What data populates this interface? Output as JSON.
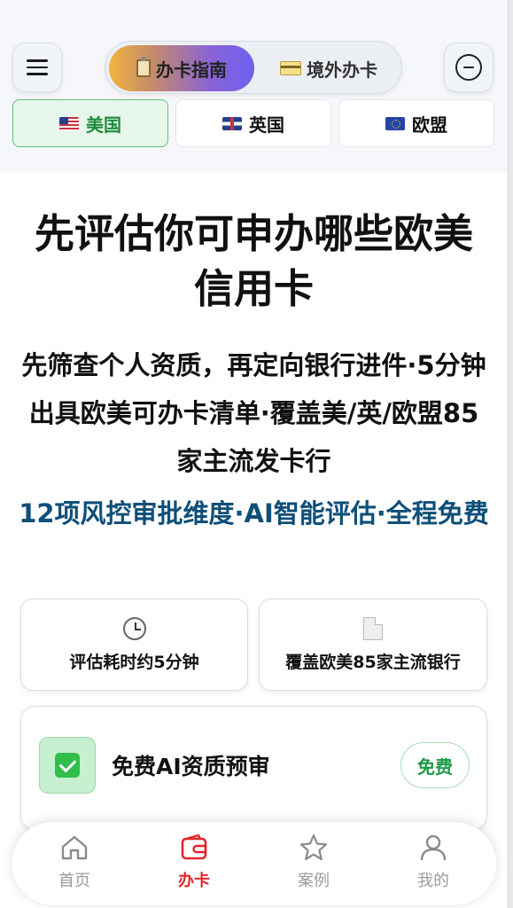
{
  "header": {
    "tabs": [
      {
        "label": "办卡指南",
        "active": true,
        "icon": "clipboard-icon"
      },
      {
        "label": "境外办卡",
        "active": false,
        "icon": "credit-card-icon"
      }
    ],
    "regions": [
      {
        "label": "美国",
        "flag": "us-flag-icon",
        "active": true
      },
      {
        "label": "英国",
        "flag": "uk-flag-icon",
        "active": false
      },
      {
        "label": "欧盟",
        "flag": "eu-flag-icon",
        "active": false
      }
    ]
  },
  "main": {
    "headline": "先评估你可申办哪些欧美信用卡",
    "subline": "先筛查个人资质，再定向银行进件·5分钟出具欧美可办卡清单·覆盖美/英/欧盟85家主流发卡行",
    "accent": "12项风控审批维度·AI智能评估·全程免费",
    "features": [
      {
        "icon": "clock-icon",
        "label": "评估耗时约5分钟"
      },
      {
        "icon": "document-icon",
        "label": "覆盖欧美85家主流银行"
      }
    ],
    "review": {
      "title": "免费AI资质预审",
      "badge": "免费"
    }
  },
  "bottom_nav": [
    {
      "label": "首页",
      "icon": "home-icon",
      "active": false
    },
    {
      "label": "办卡",
      "icon": "wallet-icon",
      "active": true
    },
    {
      "label": "案例",
      "icon": "star-icon",
      "active": false
    },
    {
      "label": "我的",
      "icon": "user-icon",
      "active": false
    }
  ],
  "colors": {
    "accent_green": "#1e8a3b",
    "accent_blue": "#0f4f78",
    "nav_active": "#e0262d",
    "nav_inactive": "#9b9b9b"
  }
}
